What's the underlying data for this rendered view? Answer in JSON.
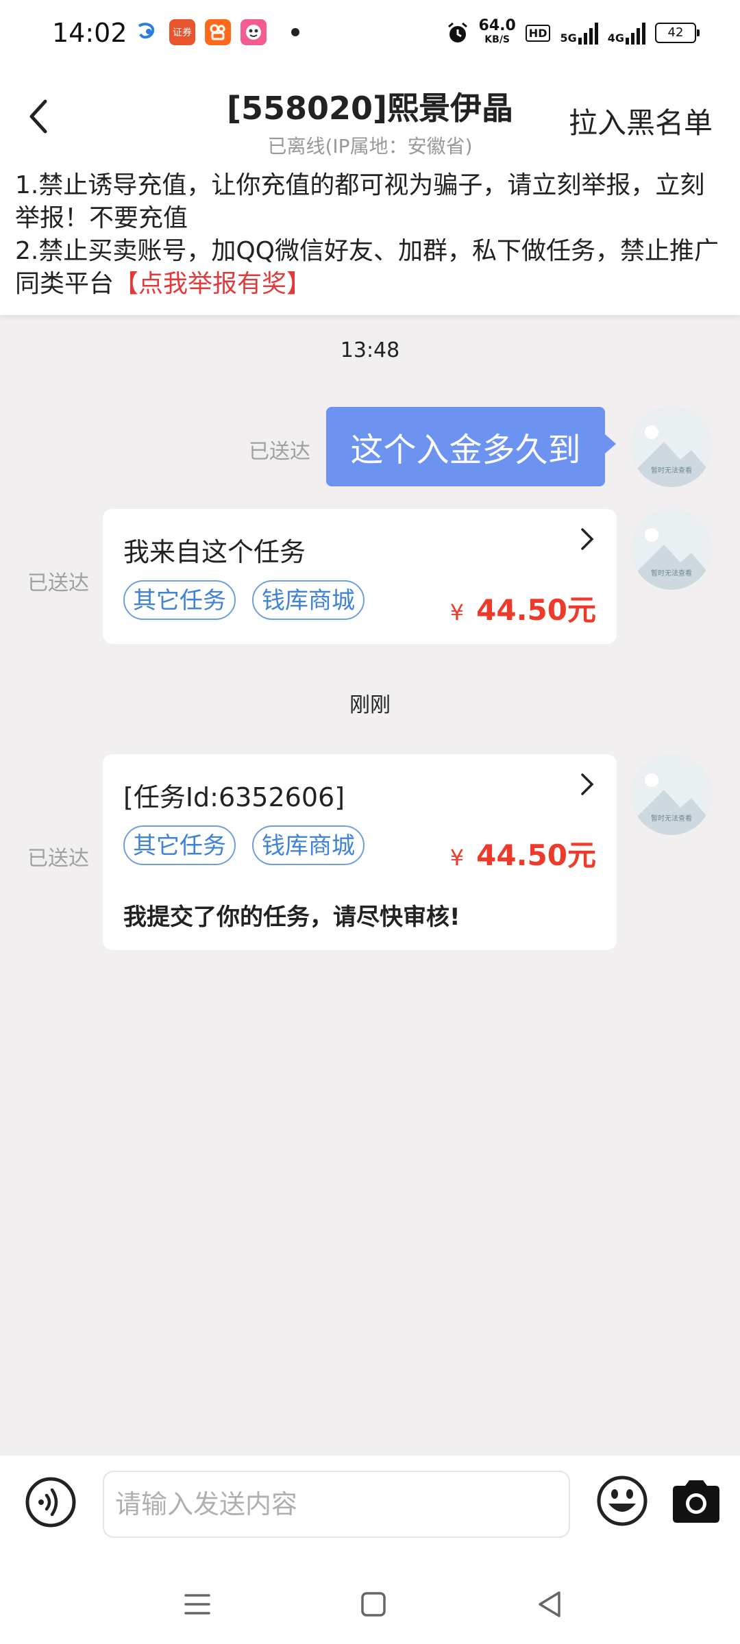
{
  "status_bar": {
    "time": "14:02",
    "apps": [
      {
        "icon": "telecom-icon",
        "label": ""
      },
      {
        "icon": "securities-app-icon",
        "label": "证券"
      },
      {
        "icon": "kuaishou-icon",
        "label": ""
      },
      {
        "icon": "cartoon-app-icon",
        "label": ""
      }
    ],
    "net_speed_value": "64.0",
    "net_speed_unit": "KB/S",
    "hd_label": "HD",
    "network_1": "5G",
    "network_2": "4G",
    "battery": "42"
  },
  "header": {
    "title": "[558020]熙景伊晶",
    "subtitle": "已离线(IP属地：安徽省)",
    "blacklist_label": "拉入黑名单"
  },
  "notice": {
    "line1": "1.禁止诱导充值，让你充值的都可视为骗子，请立刻举报，立刻举报！不要充值",
    "line2_prefix": "2.禁止买卖账号，加QQ微信好友、加群，私下做任务，禁止推广同类平台",
    "report_link": "【点我举报有奖】"
  },
  "chat": {
    "timestamp1": "13:48",
    "message1": {
      "text": "这个入金多久到",
      "status": "已送达"
    },
    "card1": {
      "title": "我来自这个任务",
      "tags": [
        "其它任务",
        "钱库商城"
      ],
      "currency": "¥",
      "price": "44.50元",
      "status": "已送达"
    },
    "timestamp2": "刚刚",
    "card2": {
      "title": "[任务Id:6352606]",
      "tags": [
        "其它任务",
        "钱库商城"
      ],
      "currency": "¥",
      "price": "44.50元",
      "note": "我提交了你的任务，请尽快审核!",
      "status": "已送达"
    },
    "avatar_caption": "暂时无法查看"
  },
  "input": {
    "placeholder": "请输入发送内容"
  },
  "colors": {
    "accent_blue": "#6c93f0",
    "price_red": "#ee3a2a",
    "report_red": "#e23a3a",
    "tag_blue": "#3f82d6"
  }
}
